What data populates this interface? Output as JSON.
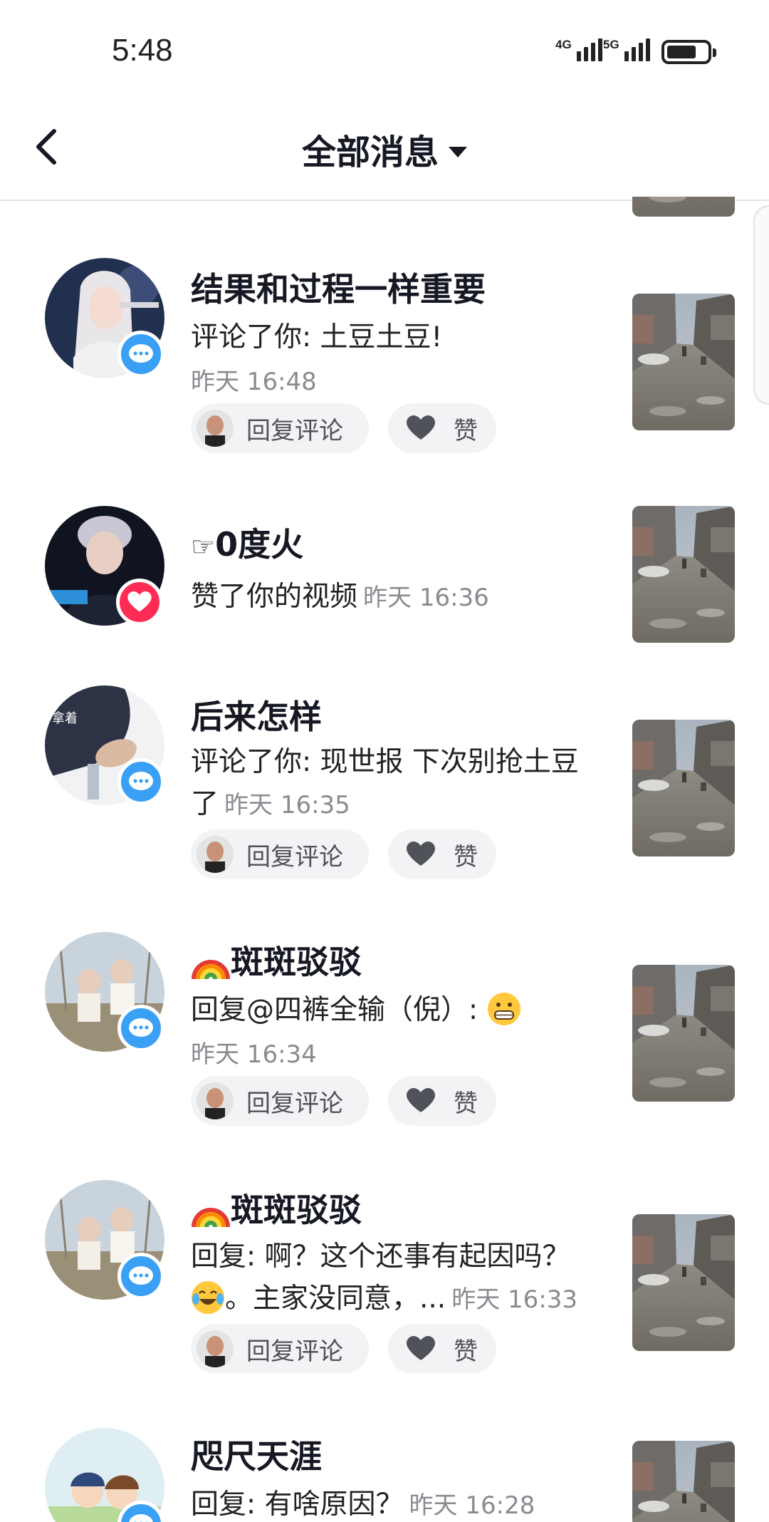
{
  "status_bar": {
    "time": "5:48",
    "network1": "4G",
    "network2": "5G"
  },
  "nav": {
    "title": "全部消息"
  },
  "actions": {
    "reply_label": "回复评论",
    "like_label": "赞"
  },
  "messages": [
    {
      "username": "结果和过程一样重要",
      "text": "评论了你: 土豆土豆!",
      "time": "昨天 16:48",
      "badge": "comment"
    },
    {
      "username": "0度火",
      "username_prefix_icon": "pointing-hand-icon",
      "text": "赞了你的视频",
      "time": "昨天 16:36",
      "badge": "like"
    },
    {
      "username": "后来怎样",
      "avatar_text": "拿着",
      "text": "评论了你: 现世报   下次别抢土豆了",
      "time": "昨天 16:35",
      "badge": "comment"
    },
    {
      "username": "斑斑驳驳",
      "username_prefix_icon": "rainbow-icon",
      "text": "回复@四裤全输（倪）:",
      "text_emoji": "grinning-emoji",
      "time": "昨天 16:34",
      "badge": "comment"
    },
    {
      "username": "斑斑驳驳",
      "username_prefix_icon": "rainbow-icon",
      "text": "回复: 啊？这个还事有起因吗？",
      "text_line2": "。主家没同意，...",
      "text_emoji": "laughing-crying-emoji",
      "time": "昨天 16:33",
      "badge": "comment"
    },
    {
      "username": "咫尺天涯",
      "text": "回复: 有啥原因？",
      "time": "昨天 16:28",
      "badge": "comment"
    }
  ],
  "colors": {
    "comment_badge": "#3aa0f5",
    "like_badge": "#fe2c55",
    "time_gray": "#8a8b91"
  }
}
